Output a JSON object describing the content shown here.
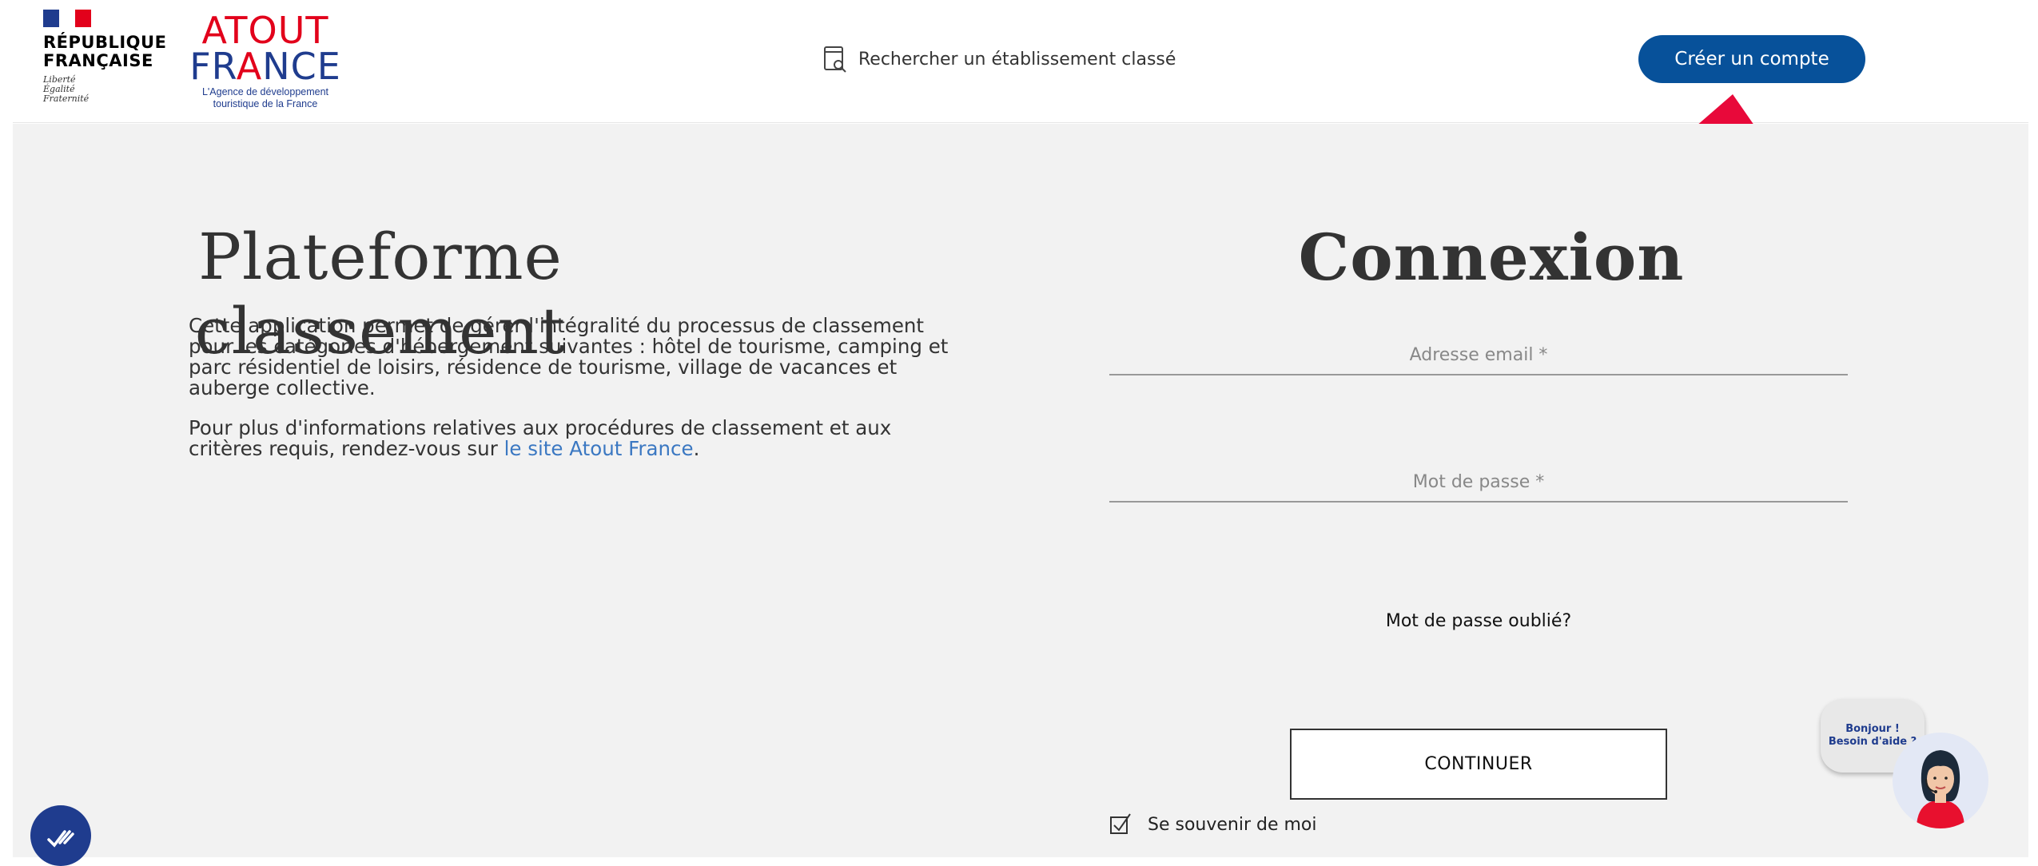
{
  "header": {
    "republique": {
      "line1": "RÉPUBLIQUE",
      "line2": "FRANÇAISE",
      "motto": [
        "Liberté",
        "Égalité",
        "Fraternité"
      ]
    },
    "atout_france": {
      "line1": "ATOUT",
      "line2_a": "FR",
      "line2_b": "A",
      "line2_c": "NCE",
      "subtitle_1": "L'Agence de développement",
      "subtitle_2": "touristique de la France"
    },
    "search_link": "Rechercher un établissement classé",
    "create_account": "Créer un compte"
  },
  "left": {
    "title": "Plateforme classement",
    "paragraph_1": "Cette application permet de gérer l'intégralité du processus de classement pour les catégories d'hébergement suivantes : hôtel de tourisme, camping et parc résidentiel de loisirs, résidence de tourisme, village de vacances et auberge collective.",
    "paragraph_2_before": "Pour plus d'informations relatives aux procédures de classement et aux critères requis, rendez-vous sur ",
    "paragraph_2_link": "le site Atout France",
    "paragraph_2_after": "."
  },
  "login": {
    "title": "Connexion",
    "email_placeholder": "Adresse email *",
    "password_placeholder": "Mot de passe *",
    "forgot": "Mot de passe oublié?",
    "continue": "CONTINUER",
    "remember": "Se souvenir de moi"
  },
  "help": {
    "line1": "Bonjour !",
    "line2": "Besoin d'aide ?"
  },
  "colors": {
    "primary": "#07519a",
    "arrow": "#e8093a",
    "af_red": "#e2011b",
    "af_blue": "#1f3c8e",
    "link": "#3b78c2",
    "background": "#f2f2f2"
  },
  "icons": [
    "search-document-icon",
    "up-arrow-icon",
    "checkbox-checked-icon",
    "accessibility-icon",
    "help-avatar-icon"
  ]
}
